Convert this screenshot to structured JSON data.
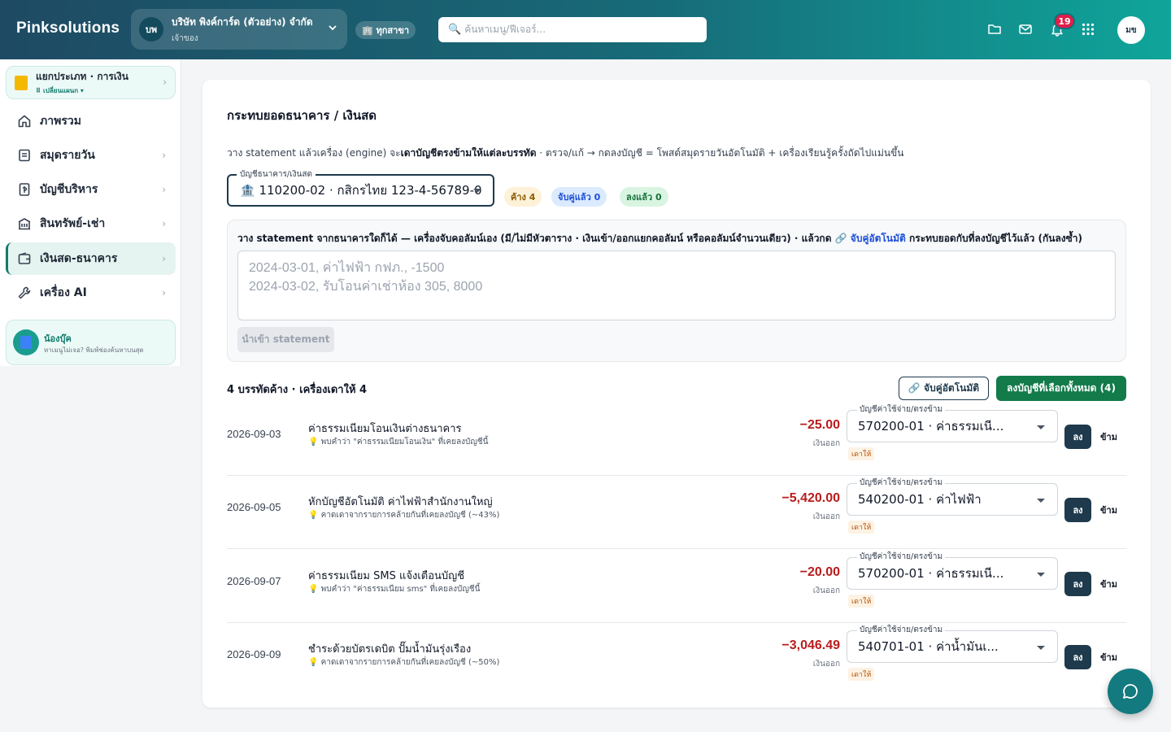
{
  "app": {
    "brand": "Pinksolutions"
  },
  "company": {
    "avatar": "บพ",
    "name": "บริษัท พิงค์การ์ด (ตัวอย่าง) จำกัด",
    "role": "เจ้าของ"
  },
  "branch": {
    "label": "🏢 ทุกสาขา"
  },
  "search": {
    "placeholder": "ค้นหาเมนู/ฟีเจอร์..."
  },
  "topbar": {
    "notification_count": "19",
    "user_initials": "มข",
    "icons": [
      "folder-icon",
      "mail-icon",
      "bell-icon",
      "apps-grid-icon"
    ]
  },
  "sidebar": {
    "module": {
      "title": "แยกประเภท · การเงิน",
      "switch_label": "⠿ เปลี่ยนแผนก ▾"
    },
    "items": [
      {
        "label": "ภาพรวม",
        "icon": "home-icon",
        "has_chevron": false
      },
      {
        "label": "สมุดรายวัน",
        "icon": "journal-icon",
        "has_chevron": true
      },
      {
        "label": "บัญชีบริหาร",
        "icon": "ledger-icon",
        "has_chevron": true
      },
      {
        "label": "สินทรัพย์-เช่า",
        "icon": "building-icon",
        "has_chevron": true
      },
      {
        "label": "เงินสด-ธนาคาร",
        "icon": "wallet-icon",
        "has_chevron": true,
        "active": true
      },
      {
        "label": "เครื่อง AI",
        "icon": "tools-icon",
        "has_chevron": true
      }
    ],
    "helper": {
      "title": "น้องบุ๊ค",
      "subtitle": "หาเมนูไม่เจอ? พิมพ์ช่องค้นหาบนสุด"
    }
  },
  "page": {
    "title": "กระทบยอดธนาคาร / เงินสด",
    "desc_prefix": "วาง statement แล้วเครื่อง (engine) จะ",
    "desc_bold": "เดาบัญชีตรงข้ามให้แต่ละบรรทัด",
    "desc_suffix": " · ตรวจ/แก้ → กดลงบัญชี = โพสต์สมุดรายวันอัตโนมัติ + เครื่องเรียนรู้ครั้งถัดไปแม่นขึ้น",
    "account_legend": "บัญชีธนาคาร/เงินสด",
    "account_value": "🏦 110200-02 · กสิกรไทย 123-4-56789-0",
    "pills": {
      "pending": "ค้าง 4",
      "matched": "จับคู่แล้ว 0",
      "posted": "ลงแล้ว 0"
    }
  },
  "import": {
    "hint_prefix": "วาง statement จากธนาคารใดก็ได้ — เครื่องจับคอลัมน์เอง (มี/ไม่มีหัวตาราง · เงินเข้า/ออกแยกคอลัมน์ หรือคอลัมน์จำนวนเดียว) · แล้วกด ",
    "hint_link": "🔗 จับคู่อัตโนมัติ",
    "hint_suffix": " กระทบยอดกับที่ลงบัญชีไว้แล้ว (กันลงซ้ำ)",
    "placeholder": "2024-03-01, ค่าไฟฟ้า กฟภ., -1500\n2024-03-02, รับโอนค่าเช่าห้อง 305, 8000",
    "button": "นำเข้า statement"
  },
  "list": {
    "heading": "4 บรรทัดค้าง · เครื่องเดาให้ 4",
    "auto_match_button": "🔗 จับคู่อัตโนมัติ",
    "post_all_button": "ลงบัญชีที่เลือกทั้งหมด (4)",
    "rows": [
      {
        "date": "2026-09-03",
        "description": "ค่าธรรมเนียมโอนเงินต่างธนาคาร",
        "hint": "💡 พบคำว่า \"ค่าธรรมเนียมโอนเงิน\" ที่เคยลงบัญชีนี้",
        "amount": "−25.00",
        "direction": "เงินออก",
        "account_legend": "บัญชีค่าใช้จ่าย/ตรงข้าม",
        "account": "570200-01 · ค่าธรรมเนี...",
        "tag": "เดาให้",
        "post": "ลง",
        "skip": "ข้าม"
      },
      {
        "date": "2026-09-05",
        "description": "หักบัญชีอัตโนมัติ ค่าไฟฟ้าสำนักงานใหญ่",
        "hint": "💡 คาดเดาจากรายการคล้ายกันที่เคยลงบัญชี (~43%)",
        "amount": "−5,420.00",
        "direction": "เงินออก",
        "account_legend": "บัญชีค่าใช้จ่าย/ตรงข้าม",
        "account": "540200-01 · ค่าไฟฟ้า",
        "tag": "เดาให้",
        "post": "ลง",
        "skip": "ข้าม"
      },
      {
        "date": "2026-09-07",
        "description": "ค่าธรรมเนียม SMS แจ้งเตือนบัญชี",
        "hint": "💡 พบคำว่า \"ค่าธรรมเนียม sms\" ที่เคยลงบัญชีนี้",
        "amount": "−20.00",
        "direction": "เงินออก",
        "account_legend": "บัญชีค่าใช้จ่าย/ตรงข้าม",
        "account": "570200-01 · ค่าธรรมเนี...",
        "tag": "เดาให้",
        "post": "ลง",
        "skip": "ข้าม"
      },
      {
        "date": "2026-09-09",
        "description": "ชำระด้วยบัตรเดบิต ปั๊มน้ำมันรุ่งเรือง",
        "hint": "💡 คาดเดาจากรายการคล้ายกันที่เคยลงบัญชี (~50%)",
        "amount": "−3,046.49",
        "direction": "เงินออก",
        "account_legend": "บัญชีค่าใช้จ่าย/ตรงข้าม",
        "account": "540701-01 · ค่าน้ำมันเ...",
        "tag": "เดาให้",
        "post": "ลง",
        "skip": "ข้าม"
      }
    ]
  },
  "chat": {
    "icon": "chat-bubble-icon"
  }
}
